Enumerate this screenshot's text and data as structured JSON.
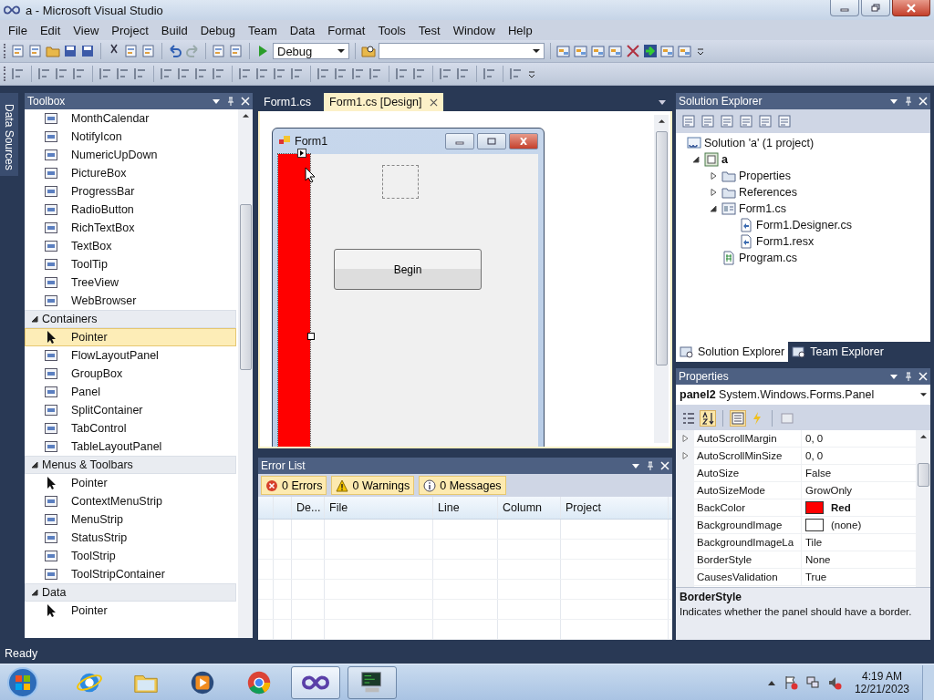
{
  "window": {
    "title": "a - Microsoft Visual Studio"
  },
  "menu": [
    "File",
    "Edit",
    "View",
    "Project",
    "Build",
    "Debug",
    "Team",
    "Data",
    "Format",
    "Tools",
    "Test",
    "Window",
    "Help"
  ],
  "toolbar": {
    "configuration": "Debug"
  },
  "side_tab": {
    "label": "Data Sources"
  },
  "toolbox": {
    "title": "Toolbox",
    "sections": [
      {
        "items": [
          {
            "kind": "control",
            "label": "MonthCalendar",
            "selected": false
          },
          {
            "kind": "control",
            "label": "NotifyIcon",
            "selected": false
          },
          {
            "kind": "control",
            "label": "NumericUpDown",
            "selected": false
          },
          {
            "kind": "control",
            "label": "PictureBox",
            "selected": false
          },
          {
            "kind": "control",
            "label": "ProgressBar",
            "selected": false
          },
          {
            "kind": "control",
            "label": "RadioButton",
            "selected": false
          },
          {
            "kind": "control",
            "label": "RichTextBox",
            "selected": false
          },
          {
            "kind": "control",
            "label": "TextBox",
            "selected": false
          },
          {
            "kind": "control",
            "label": "ToolTip",
            "selected": false
          },
          {
            "kind": "control",
            "label": "TreeView",
            "selected": false
          },
          {
            "kind": "control",
            "label": "WebBrowser",
            "selected": false
          }
        ]
      },
      {
        "header": "Containers",
        "expanded": true,
        "items": [
          {
            "kind": "pointer",
            "label": "Pointer",
            "selected": true
          },
          {
            "kind": "control",
            "label": "FlowLayoutPanel",
            "selected": false
          },
          {
            "kind": "control",
            "label": "GroupBox",
            "selected": false
          },
          {
            "kind": "control",
            "label": "Panel",
            "selected": false
          },
          {
            "kind": "control",
            "label": "SplitContainer",
            "selected": false
          },
          {
            "kind": "control",
            "label": "TabControl",
            "selected": false
          },
          {
            "kind": "control",
            "label": "TableLayoutPanel",
            "selected": false
          }
        ]
      },
      {
        "header": "Menus & Toolbars",
        "expanded": true,
        "items": [
          {
            "kind": "pointer",
            "label": "Pointer",
            "selected": false
          },
          {
            "kind": "control",
            "label": "ContextMenuStrip",
            "selected": false
          },
          {
            "kind": "control",
            "label": "MenuStrip",
            "selected": false
          },
          {
            "kind": "control",
            "label": "StatusStrip",
            "selected": false
          },
          {
            "kind": "control",
            "label": "ToolStrip",
            "selected": false
          },
          {
            "kind": "control",
            "label": "ToolStripContainer",
            "selected": false
          }
        ]
      },
      {
        "header": "Data",
        "expanded": true,
        "items": [
          {
            "kind": "pointer",
            "label": "Pointer",
            "selected": false
          }
        ]
      }
    ]
  },
  "editor_tabs": [
    {
      "label": "Form1.cs",
      "selected": false
    },
    {
      "label": "Form1.cs [Design]",
      "selected": true
    }
  ],
  "form": {
    "title": "Form1",
    "button": "Begin"
  },
  "error_list": {
    "title": "Error List",
    "filters": [
      {
        "kind": "error",
        "label": "0 Errors",
        "selected": true
      },
      {
        "kind": "warning",
        "label": "0 Warnings",
        "selected": true
      },
      {
        "kind": "message",
        "label": "0 Messages",
        "selected": true
      }
    ],
    "columns": [
      "De...",
      "File",
      "Line",
      "Column",
      "Project"
    ]
  },
  "solution_explorer": {
    "title": "Solution Explorer",
    "tree": [
      {
        "kind": "solution",
        "label": "Solution 'a' (1 project)",
        "children": [
          {
            "kind": "project",
            "label": "a",
            "expanded": true,
            "children": [
              {
                "kind": "folder",
                "label": "Properties",
                "expanded": false
              },
              {
                "kind": "references",
                "label": "References",
                "expanded": false
              },
              {
                "kind": "form",
                "label": "Form1.cs",
                "expanded": true,
                "children": [
                  {
                    "kind": "file",
                    "label": "Form1.Designer.cs"
                  },
                  {
                    "kind": "file",
                    "label": "Form1.resx"
                  }
                ]
              },
              {
                "kind": "code",
                "label": "Program.cs"
              }
            ]
          }
        ]
      }
    ],
    "tabs": [
      {
        "label": "Solution Explorer",
        "selected": true
      },
      {
        "label": "Team Explorer",
        "selected": false
      }
    ]
  },
  "properties": {
    "title": "Properties",
    "object_name": "panel2",
    "object_type": "System.Windows.Forms.Panel",
    "rows": [
      {
        "name": "AutoScrollMargin",
        "value": "0, 0",
        "expandable": true
      },
      {
        "name": "AutoScrollMinSize",
        "value": "0, 0",
        "expandable": true
      },
      {
        "name": "AutoSize",
        "value": "False"
      },
      {
        "name": "AutoSizeMode",
        "value": "GrowOnly"
      },
      {
        "name": "BackColor",
        "value": "Red",
        "color": "#ff0000",
        "modified": true
      },
      {
        "name": "BackgroundImage",
        "value": "(none)",
        "color": "#ffffff"
      },
      {
        "name": "BackgroundImageLa",
        "value": "Tile"
      },
      {
        "name": "BorderStyle",
        "value": "None"
      },
      {
        "name": "CausesValidation",
        "value": "True"
      }
    ],
    "description": {
      "title": "BorderStyle",
      "text": "Indicates whether the panel should have a border."
    }
  },
  "status_bar": {
    "text": "Ready"
  },
  "taskbar": {
    "apps": [
      {
        "kind": "ie",
        "running": false,
        "selected": false
      },
      {
        "kind": "explorer",
        "running": false,
        "selected": false
      },
      {
        "kind": "media",
        "running": false,
        "selected": false
      },
      {
        "kind": "chrome",
        "running": false,
        "selected": false
      },
      {
        "kind": "vs",
        "running": true,
        "selected": true
      },
      {
        "kind": "monitor",
        "running": true,
        "selected": false
      }
    ],
    "clock": {
      "time": "4:19 AM",
      "date": "12/21/2023"
    }
  }
}
